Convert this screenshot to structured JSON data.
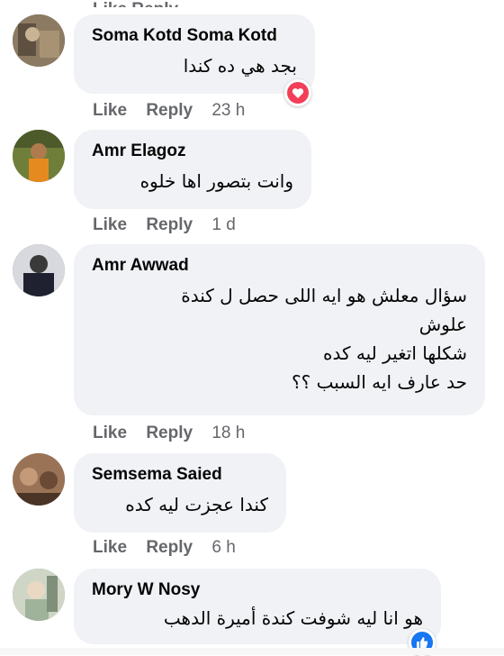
{
  "comments": [
    {
      "author": "Soma Kotd Soma Kotd",
      "lines": [
        "بجد هي ده كندا"
      ],
      "like_label": "Like",
      "reply_label": "Reply",
      "time": "23 h",
      "reaction": "love-icon",
      "avatar_color": "#7b6a55"
    },
    {
      "author": "Amr Elagoz",
      "lines": [
        "وانت بتصور اها خلوه"
      ],
      "like_label": "Like",
      "reply_label": "Reply",
      "time": "1 d",
      "avatar_color": "#c9782e"
    },
    {
      "author": "Amr Awwad",
      "lines": [
        "سؤال معلش هو ايه اللى حصل ل كندة",
        "علوش",
        "شكلها اتغير ليه كده",
        "حد عارف ايه السبب ؟؟"
      ],
      "like_label": "Like",
      "reply_label": "Reply",
      "time": "18 h",
      "avatar_color": "#2f3140"
    },
    {
      "author": "Semsema Saied",
      "lines": [
        "كندا عجزت ليه كده"
      ],
      "like_label": "Like",
      "reply_label": "Reply",
      "time": "6 h",
      "avatar_color": "#8b5a3c"
    },
    {
      "author": "Mory W Nosy",
      "lines": [
        "هو انا ليه شوفت كندة أميرة الدهب"
      ],
      "reaction": "like-icon",
      "avatar_color": "#b9c2b0"
    }
  ],
  "colors": {
    "bubble": "#f0f2f5",
    "meta_text": "#65676b",
    "love": "#f33e58",
    "like": "#1877f2"
  }
}
